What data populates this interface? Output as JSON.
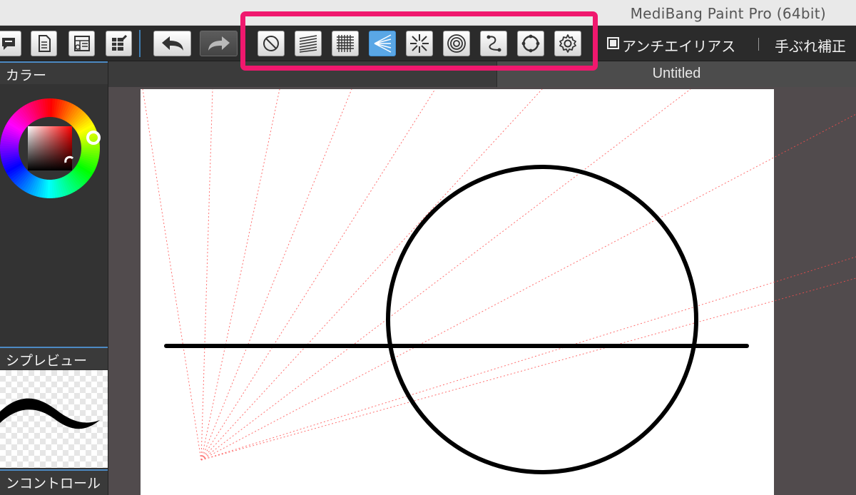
{
  "window": {
    "title": "MediBang Paint Pro (64bit)"
  },
  "toolbar": {
    "antialias_label": "アンチエイリアス",
    "stabilizer_label": "手ぶれ補正",
    "snap_buttons": [
      {
        "name": "snap-off",
        "icon": "no-snap-icon"
      },
      {
        "name": "parallel-snap",
        "icon": "parallel-lines-icon"
      },
      {
        "name": "cross-snap",
        "icon": "grid-icon"
      },
      {
        "name": "vanishing-point-snap",
        "icon": "vanishing-point-icon",
        "active": true
      },
      {
        "name": "radial-snap",
        "icon": "radial-lines-icon"
      },
      {
        "name": "concentric-snap",
        "icon": "concentric-circles-icon"
      },
      {
        "name": "curve-snap",
        "icon": "curve-icon"
      },
      {
        "name": "ellipse-snap",
        "icon": "ellipse-icon"
      },
      {
        "name": "snap-settings",
        "icon": "gear-icon"
      }
    ],
    "highlight_color": "#f0186e",
    "active_color": "#5aa7e6"
  },
  "panels": {
    "color": {
      "title": "カラー"
    },
    "brush_preview": {
      "title": "シプレビュー"
    },
    "control": {
      "title": "ンコントロール"
    }
  },
  "document": {
    "tab_title": "Untitled"
  }
}
